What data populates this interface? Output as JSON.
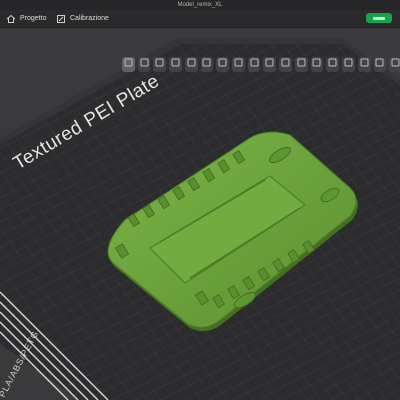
{
  "window": {
    "title": "Model_remix_XL"
  },
  "menubar": {
    "tabs": [
      {
        "label": "Progetto",
        "icon": "home-icon"
      },
      {
        "label": "Calibrazione",
        "icon": "calibration-icon"
      }
    ],
    "status_color": "#17a34a"
  },
  "toolbar": {
    "tools": [
      "orient-icon",
      "arrange-icon",
      "add-object-icon",
      "delete-icon",
      "split-icon",
      "scale-icon",
      "rotate-icon",
      "move-icon",
      "cut-icon",
      "paint-icon",
      "seam-icon",
      "support-icon",
      "measure-icon",
      "text-icon",
      "assembly-icon",
      "mesh-icon",
      "layout-icon",
      "view-icon"
    ]
  },
  "viewport": {
    "plate_label": "Textured PEI Plate",
    "plate_side_label": "PLA/ABS/PETG",
    "model_color": "#6aa23a",
    "plate_color": "#2c2c2f"
  }
}
